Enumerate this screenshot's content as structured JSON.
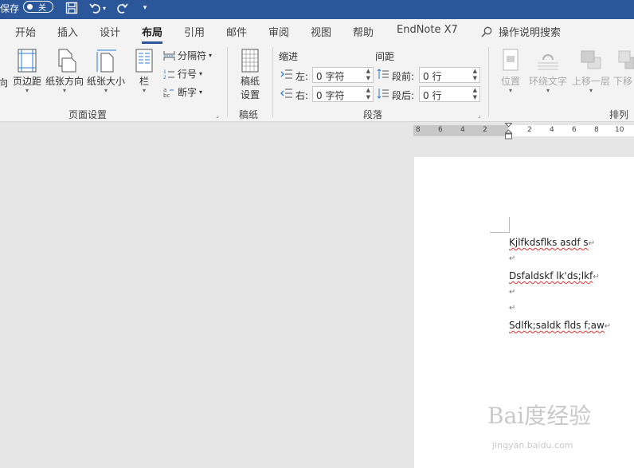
{
  "titlebar": {
    "autosave_label": "保存",
    "autosave_state": "关"
  },
  "tabs": [
    "开始",
    "插入",
    "设计",
    "布局",
    "引用",
    "邮件",
    "审阅",
    "视图",
    "帮助",
    "EndNote X7"
  ],
  "active_tab": "布局",
  "tellme": "操作说明搜索",
  "ribbon": {
    "page_setup": {
      "partial": "向",
      "margins": "页边距",
      "orientation": "纸张方向",
      "size": "纸张大小",
      "columns": "栏",
      "breaks": "分隔符",
      "line_numbers": "行号",
      "hyphenation": "断字",
      "label": "页面设置"
    },
    "draft": {
      "button_line1": "稿纸",
      "button_line2": "设置",
      "label": "稿纸"
    },
    "paragraph": {
      "indent_title": "缩进",
      "spacing_title": "间距",
      "left_label": "左:",
      "left_value": "0 字符",
      "right_label": "右:",
      "right_value": "0 字符",
      "before_label": "段前:",
      "before_value": "0 行",
      "after_label": "段后:",
      "after_value": "0 行",
      "label": "段落"
    },
    "arrange": {
      "position": "位置",
      "wrap_text": "环绕文字",
      "bring_forward": "上移一层",
      "send_backward": "下移",
      "label": "排列"
    }
  },
  "ruler_ticks": [
    "8",
    "6",
    "4",
    "2",
    "2",
    "4",
    "6",
    "8",
    "10"
  ],
  "document": {
    "paragraphs": [
      "Kjlfkdsflks asdf s",
      "",
      "Dsfaldskf lk'ds;lkf",
      "",
      "",
      "Sdlfk;saldk flds f;aw"
    ]
  },
  "watermark": {
    "logo": "Bai度经验",
    "url": "jingyan.baidu.com"
  }
}
